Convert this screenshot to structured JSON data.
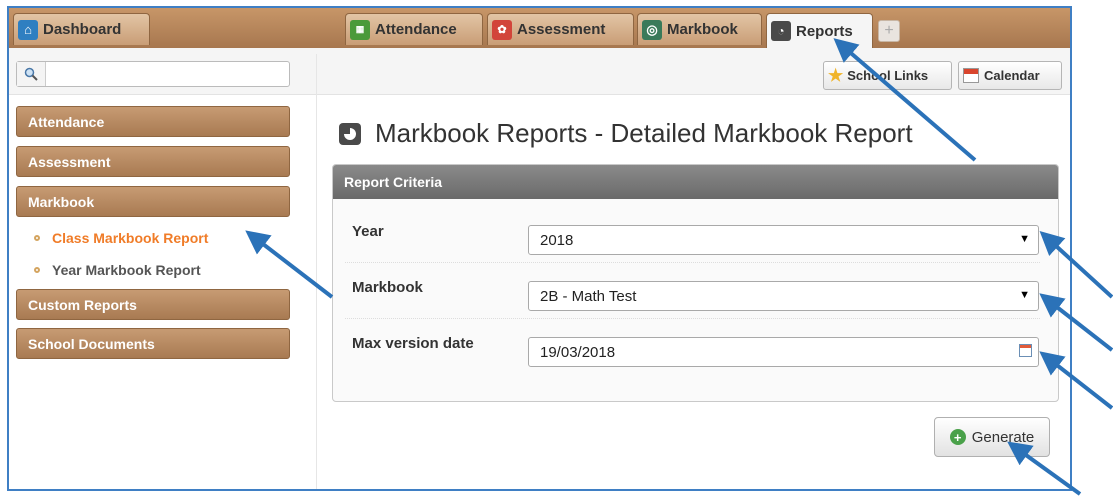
{
  "tabs": {
    "dashboard": "Dashboard",
    "attendance": "Attendance",
    "assessment": "Assessment",
    "markbook": "Markbook",
    "reports": "Reports",
    "add": "+"
  },
  "toolbar": {
    "search_placeholder": "",
    "school_links": "School Links",
    "calendar": "Calendar"
  },
  "sidebar": {
    "attendance": "Attendance",
    "assessment": "Assessment",
    "markbook": "Markbook",
    "class_markbook_report": "Class Markbook Report",
    "year_markbook_report": "Year Markbook Report",
    "custom_reports": "Custom Reports",
    "school_documents": "School Documents"
  },
  "main": {
    "title": "Markbook Reports - Detailed Markbook Report",
    "panel_title": "Report Criteria",
    "fields": {
      "year_label": "Year",
      "year_value": "2018",
      "markbook_label": "Markbook",
      "markbook_value": "2B - Math Test",
      "max_version_label": "Max version date",
      "max_version_value": "19/03/2018"
    },
    "generate": "Generate"
  },
  "colors": {
    "tab_bar": "#b88a60",
    "annotation_arrow": "#2b72b8",
    "active_link": "#f07c28"
  }
}
